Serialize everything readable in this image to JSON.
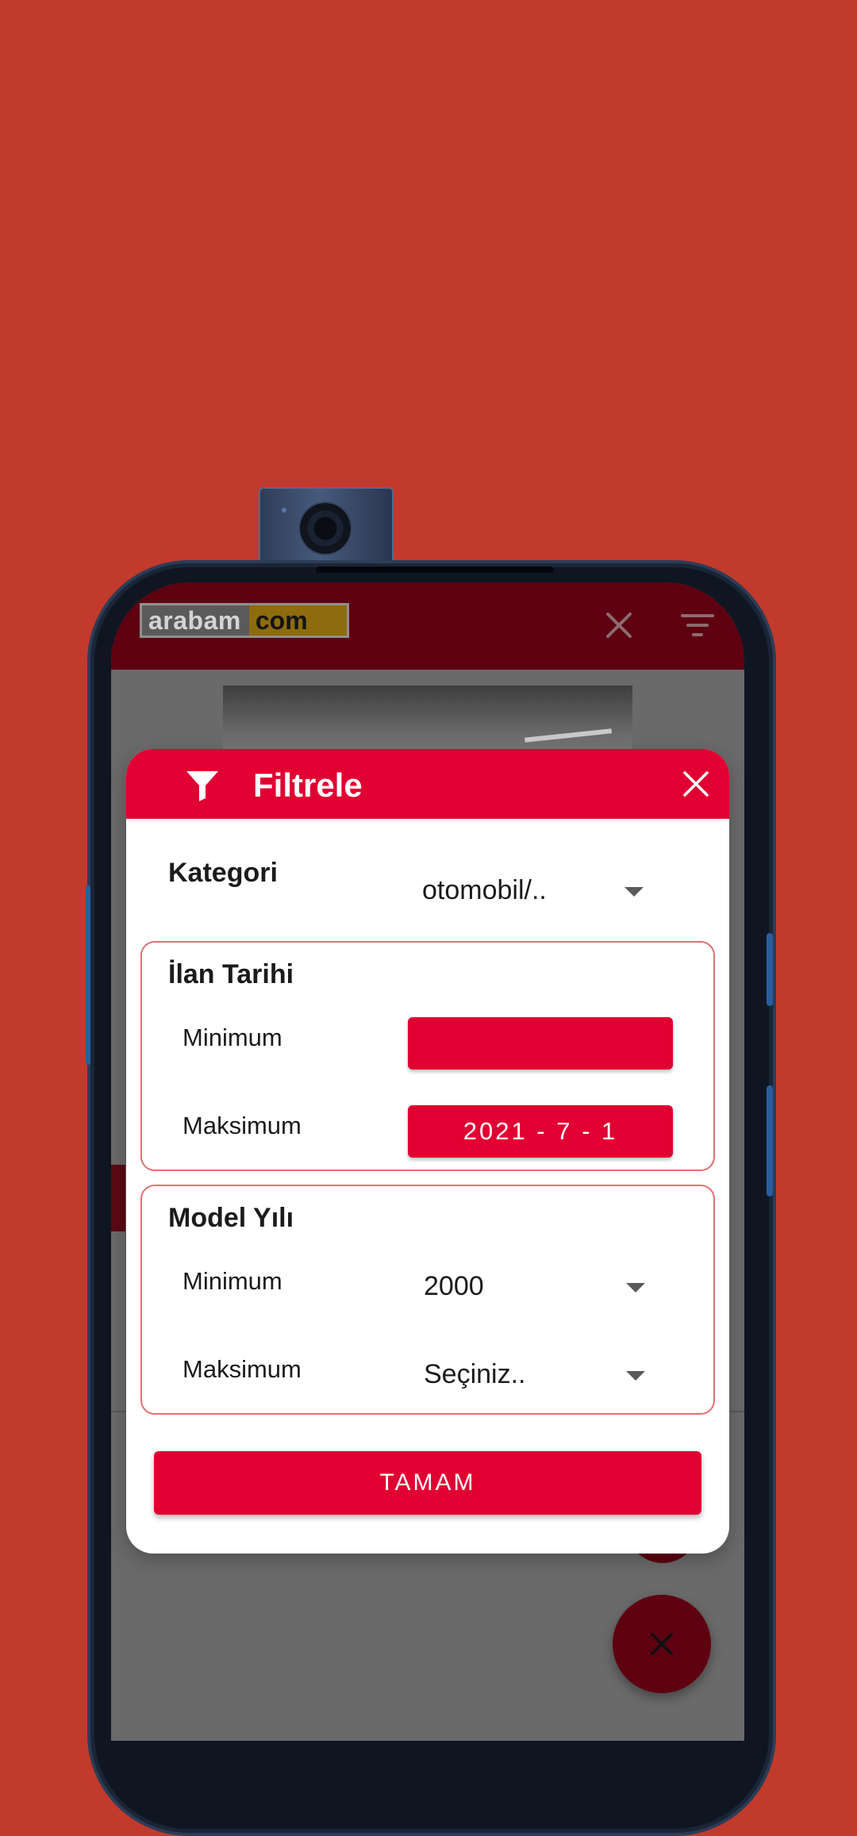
{
  "app": {
    "logo_left": "arabam",
    "logo_right": "com"
  },
  "dialog": {
    "title": "Filtrele",
    "category": {
      "label": "Kategori",
      "value": "otomobil/.."
    },
    "listing_date": {
      "label": "İlan Tarihi",
      "min_label": "Minimum",
      "min_value": "",
      "max_label": "Maksimum",
      "max_value": "2021 - 7 - 1"
    },
    "model_year": {
      "label": "Model Yılı",
      "min_label": "Minimum",
      "min_value": "2000",
      "max_label": "Maksimum",
      "max_value": "Seçiniz.."
    },
    "ok_label": "TAMAM"
  },
  "colors": {
    "background": "#c23a2c",
    "accent": "#e10032",
    "app_bar_dimmed": "#5e0010",
    "section_border": "#e27070"
  },
  "icons": {
    "camera": "camera-icon",
    "app_close": "close-icon",
    "app_filter": "filter-lines-icon",
    "dialog_filter": "funnel-icon",
    "dialog_close": "close-icon",
    "dropdown": "caret-down-icon",
    "fab": "close-icon"
  }
}
